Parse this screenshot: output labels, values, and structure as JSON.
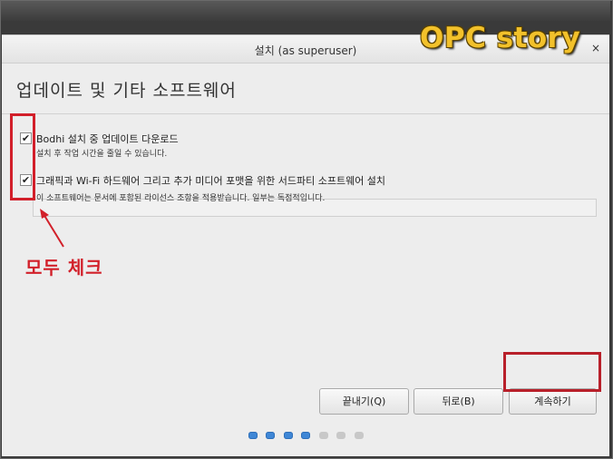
{
  "window": {
    "title": "설치 (as superuser)",
    "close_glyph": "×"
  },
  "watermark": "OPC story",
  "page": {
    "heading": "업데이트 및 기타 소프트웨어"
  },
  "options": [
    {
      "label": "Bodhi 설치 중 업데이트 다운로드",
      "sub": "설치 후 작업 시간을 줄일 수 있습니다.",
      "checked": true
    },
    {
      "label": "그래픽과 Wi-Fi 하드웨어 그리고 추가 미디어 포맷을 위한 서드파티 소프트웨어 설치",
      "sub": "이 소프트웨어는 문서에 포함된 라이선스 조항을 적용받습니다. 일부는 독점적입니다.",
      "checked": true
    }
  ],
  "annotation": {
    "text": "모두 체크",
    "color": "#d2202a"
  },
  "buttons": {
    "quit": "끝내기(Q)",
    "back": "뒤로(B)",
    "continue": "계속하기"
  },
  "progress": {
    "total": 7,
    "done": 4,
    "active_color": "#3f87d6",
    "inactive_color": "#c8c8c8"
  }
}
